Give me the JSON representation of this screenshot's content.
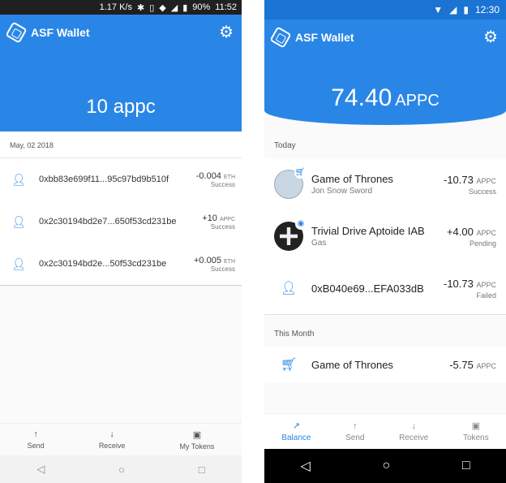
{
  "left": {
    "status": {
      "speed": "1.17 K/s",
      "battery": "90%",
      "time": "11:52"
    },
    "header": {
      "title": "ASF Wallet",
      "balance": "10 appc"
    },
    "date": "May, 02 2018",
    "transactions": [
      {
        "address": "0xbb83e699f11...95c97bd9b510f",
        "value": "-0.004",
        "currency": "ETH",
        "status": "Success"
      },
      {
        "address": "0x2c30194bd2e7...650f53cd231be",
        "value": "+10",
        "currency": "APPC",
        "status": "Success"
      },
      {
        "address": "0x2c30194bd2e...50f53cd231be",
        "value": "+0.005",
        "currency": "ETH",
        "status": "Success"
      }
    ],
    "nav": {
      "send": "Send",
      "receive": "Receive",
      "tokens": "My Tokens"
    }
  },
  "right": {
    "status": {
      "time": "12:30"
    },
    "header": {
      "title": "ASF Wallet",
      "balance": "74.40",
      "currency": "APPC"
    },
    "sections": {
      "today": "Today",
      "month": "This Month"
    },
    "transactions": [
      {
        "title": "Game of Thrones",
        "sub": "Jon Snow Sword",
        "value": "-10.73",
        "currency": "APPC",
        "status": "Success"
      },
      {
        "title": "Trivial Drive Aptoide IAB",
        "sub": "Gas",
        "value": "+4.00",
        "currency": "APPC",
        "status": "Pending"
      },
      {
        "title": "0xB040e69...EFA033dB",
        "sub": "",
        "value": "-10.73",
        "currency": "APPC",
        "status": "Failed"
      },
      {
        "title": "Game of Thrones",
        "sub": "",
        "value": "-5.75",
        "currency": "APPC",
        "status": ""
      }
    ],
    "nav": {
      "balance": "Balance",
      "send": "Send",
      "receive": "Receive",
      "tokens": "Tokens"
    }
  },
  "colors": {
    "accent": "#2a86e6"
  }
}
